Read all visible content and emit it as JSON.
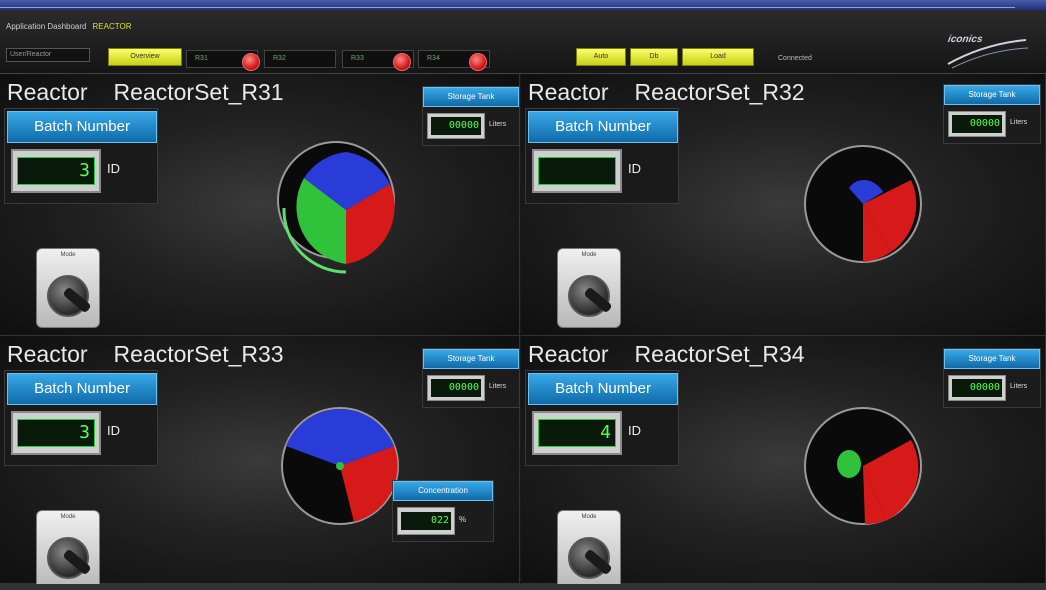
{
  "header": {
    "app_title": "Application Dashboard",
    "app_title_accent": "REACTOR",
    "user_field": "User/Reactor",
    "btn_overview": "Overview",
    "slots": [
      "R31",
      "R32",
      "R33",
      "R34"
    ],
    "btn_a": "Auto",
    "btn_b": "Db",
    "btn_c": "Load",
    "status": "Connected",
    "logo": "iconics"
  },
  "colors": {
    "accent_yellow": "#fbff6a",
    "panel_blue": "#1b8ad0",
    "lcd_green": "#55ff55",
    "gauge_red": "#d61a1a",
    "gauge_green": "#2fc23a",
    "gauge_blue": "#2a3cd8"
  },
  "panels": [
    {
      "label": "Reactor",
      "set": "ReactorSet_R31",
      "batch_label": "Batch Number",
      "batch_value": "3",
      "batch_unit": "ID",
      "storage_label": "Storage Tank",
      "storage_value": "00000",
      "storage_unit": "Liters",
      "switch_label": "Mode",
      "gauge_icon": "pie-gauge-icon"
    },
    {
      "label": "Reactor",
      "set": "ReactorSet_R32",
      "batch_label": "Batch Number",
      "batch_value": "",
      "batch_unit": "ID",
      "storage_label": "Storage Tank",
      "storage_value": "00000",
      "storage_unit": "Liters",
      "switch_label": "Mode",
      "gauge_icon": "pie-gauge-icon"
    },
    {
      "label": "Reactor",
      "set": "ReactorSet_R33",
      "batch_label": "Batch Number",
      "batch_value": "3",
      "batch_unit": "ID",
      "storage_label": "Storage Tank",
      "storage_value": "00000",
      "storage_unit": "Liters",
      "switch_label": "Mode",
      "gauge_icon": "pie-gauge-icon",
      "calc_label": "Concentration",
      "calc_value": "022",
      "calc_unit": "%"
    },
    {
      "label": "Reactor",
      "set": "ReactorSet_R34",
      "batch_label": "Batch Number",
      "batch_value": "4",
      "batch_unit": "ID",
      "storage_label": "Storage Tank",
      "storage_value": "00000",
      "storage_unit": "Liters",
      "switch_label": "Mode",
      "gauge_icon": "pie-gauge-icon"
    }
  ]
}
